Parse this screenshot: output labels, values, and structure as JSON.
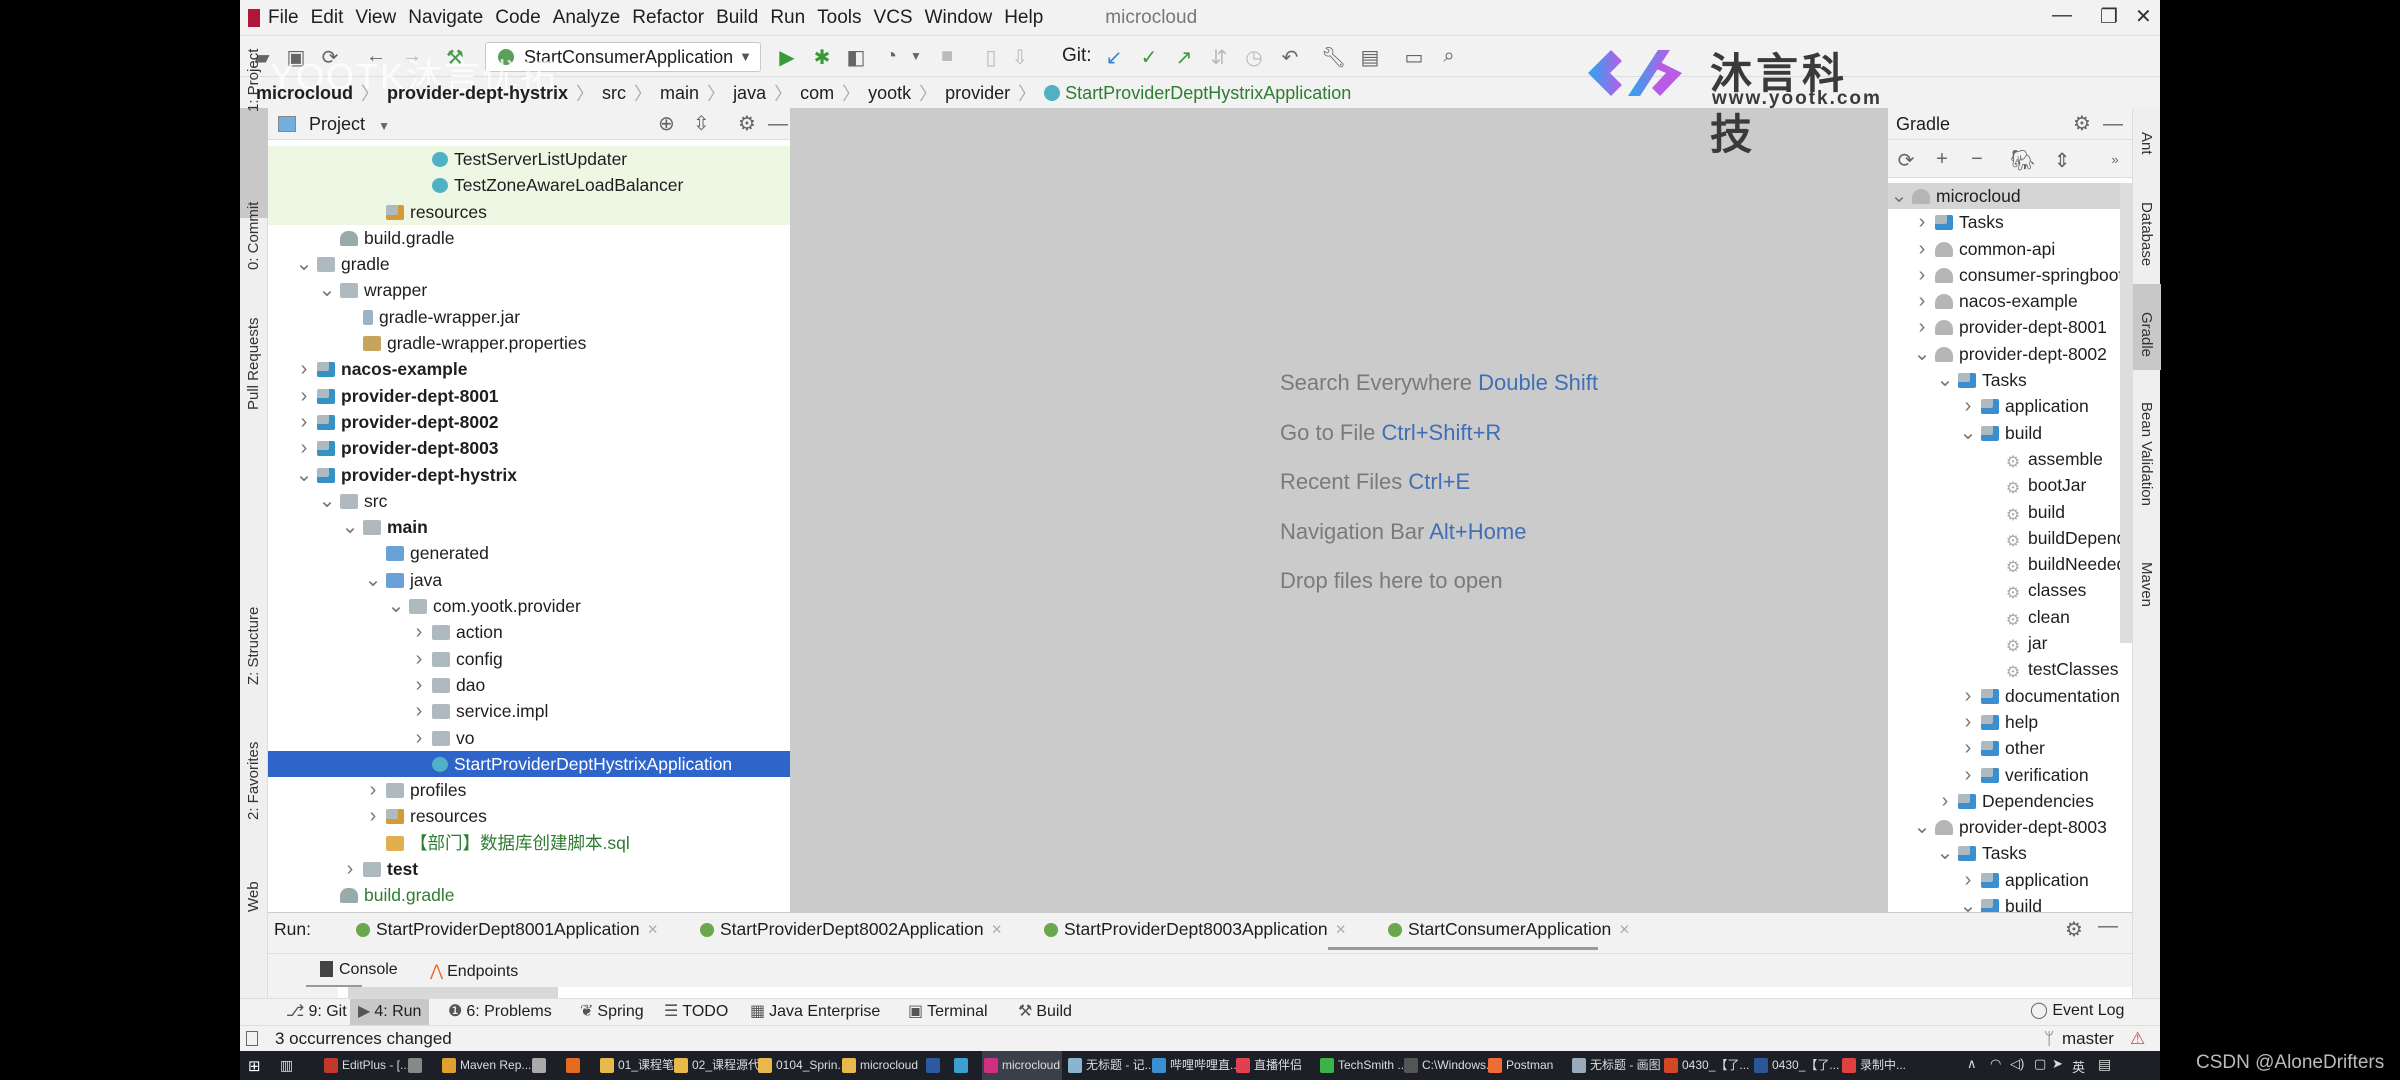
{
  "window": {
    "title": "microcloud"
  },
  "menu": [
    "File",
    "Edit",
    "View",
    "Navigate",
    "Code",
    "Analyze",
    "Refactor",
    "Build",
    "Run",
    "Tools",
    "VCS",
    "Window",
    "Help"
  ],
  "toolbar": {
    "run_config": "StartConsumerApplication",
    "git_label": "Git:"
  },
  "watermark": "YOOTK沐言优拓",
  "logo": {
    "name": "沐言科技",
    "url": "www.yootk.com"
  },
  "breadcrumb": [
    "microcloud",
    "provider-dept-hystrix",
    "src",
    "main",
    "java",
    "com",
    "yootk",
    "provider",
    "StartProviderDeptHystrixApplication"
  ],
  "left_stripe": [
    "1: Project",
    "0: Commit",
    "Pull Requests",
    "Z: Structure",
    "2: Favorites",
    "Web"
  ],
  "right_stripe": [
    "Ant",
    "Database",
    "Gradle",
    "Bean Validation",
    "Maven"
  ],
  "project": {
    "title": "Project",
    "rows": [
      {
        "label": "TestServerListUpdater",
        "level": 6,
        "arrow": "",
        "icon": "cls",
        "style": "hl"
      },
      {
        "label": "TestZoneAwareLoadBalancer",
        "level": 6,
        "arrow": "",
        "icon": "cls",
        "style": "hl"
      },
      {
        "label": "resources",
        "level": 4,
        "arrow": "",
        "icon": "res",
        "style": "hl"
      },
      {
        "label": "build.gradle",
        "level": 2,
        "arrow": "",
        "icon": "gradle",
        "style": ""
      },
      {
        "label": "gradle",
        "level": 1,
        "arrow": "expanded",
        "icon": "folder",
        "style": ""
      },
      {
        "label": "wrapper",
        "level": 2,
        "arrow": "expanded",
        "icon": "folder",
        "style": ""
      },
      {
        "label": "gradle-wrapper.jar",
        "level": 3,
        "arrow": "",
        "icon": "jar",
        "style": ""
      },
      {
        "label": "gradle-wrapper.properties",
        "level": 3,
        "arrow": "",
        "icon": "props",
        "style": ""
      },
      {
        "label": "nacos-example",
        "level": 1,
        "arrow": "collapsed",
        "icon": "module",
        "style": "bold"
      },
      {
        "label": "provider-dept-8001",
        "level": 1,
        "arrow": "collapsed",
        "icon": "module",
        "style": "bold"
      },
      {
        "label": "provider-dept-8002",
        "level": 1,
        "arrow": "collapsed",
        "icon": "module",
        "style": "bold"
      },
      {
        "label": "provider-dept-8003",
        "level": 1,
        "arrow": "collapsed",
        "icon": "module",
        "style": "bold"
      },
      {
        "label": "provider-dept-hystrix",
        "level": 1,
        "arrow": "expanded",
        "icon": "module",
        "style": "bold"
      },
      {
        "label": "src",
        "level": 2,
        "arrow": "expanded",
        "icon": "folder",
        "style": ""
      },
      {
        "label": "main",
        "level": 3,
        "arrow": "expanded",
        "icon": "folder",
        "style": "bold"
      },
      {
        "label": "generated",
        "level": 4,
        "arrow": "",
        "icon": "src",
        "style": ""
      },
      {
        "label": "java",
        "level": 4,
        "arrow": "expanded",
        "icon": "src",
        "style": ""
      },
      {
        "label": "com.yootk.provider",
        "level": 5,
        "arrow": "expanded",
        "icon": "folder",
        "style": ""
      },
      {
        "label": "action",
        "level": 6,
        "arrow": "collapsed",
        "icon": "folder",
        "style": ""
      },
      {
        "label": "config",
        "level": 6,
        "arrow": "collapsed",
        "icon": "folder",
        "style": ""
      },
      {
        "label": "dao",
        "level": 6,
        "arrow": "collapsed",
        "icon": "folder",
        "style": ""
      },
      {
        "label": "service.impl",
        "level": 6,
        "arrow": "collapsed",
        "icon": "folder",
        "style": ""
      },
      {
        "label": "vo",
        "level": 6,
        "arrow": "collapsed",
        "icon": "folder",
        "style": ""
      },
      {
        "label": "StartProviderDeptHystrixApplication",
        "level": 6,
        "arrow": "",
        "icon": "cls",
        "style": "sel"
      },
      {
        "label": "profiles",
        "level": 4,
        "arrow": "collapsed",
        "icon": "folder",
        "style": ""
      },
      {
        "label": "resources",
        "level": 4,
        "arrow": "collapsed",
        "icon": "res",
        "style": ""
      },
      {
        "label": "【部门】数据库创建脚本.sql",
        "level": 4,
        "arrow": "",
        "icon": "sql",
        "style": "green"
      },
      {
        "label": "test",
        "level": 3,
        "arrow": "collapsed",
        "icon": "folder",
        "style": "bold"
      },
      {
        "label": "build.gradle",
        "level": 2,
        "arrow": "",
        "icon": "gradle",
        "style": "green"
      }
    ]
  },
  "editor_hints": [
    {
      "text": "Search Everywhere",
      "key": "Double Shift"
    },
    {
      "text": "Go to File",
      "key": "Ctrl+Shift+R"
    },
    {
      "text": "Recent Files",
      "key": "Ctrl+E"
    },
    {
      "text": "Navigation Bar",
      "key": "Alt+Home"
    },
    {
      "text": "Drop files here to open",
      "key": ""
    }
  ],
  "gradle": {
    "title": "Gradle",
    "rows": [
      {
        "label": "microcloud",
        "level": 0,
        "arrow": "expanded",
        "icon": "gr",
        "style": "gsel"
      },
      {
        "label": "Tasks",
        "level": 1,
        "arrow": "collapsed",
        "icon": "task",
        "style": ""
      },
      {
        "label": "common-api",
        "level": 1,
        "arrow": "collapsed",
        "icon": "gr",
        "style": ""
      },
      {
        "label": "consumer-springboot",
        "level": 1,
        "arrow": "collapsed",
        "icon": "gr",
        "style": ""
      },
      {
        "label": "nacos-example",
        "level": 1,
        "arrow": "collapsed",
        "icon": "gr",
        "style": ""
      },
      {
        "label": "provider-dept-8001",
        "level": 1,
        "arrow": "collapsed",
        "icon": "gr",
        "style": ""
      },
      {
        "label": "provider-dept-8002",
        "level": 1,
        "arrow": "expanded",
        "icon": "gr",
        "style": ""
      },
      {
        "label": "Tasks",
        "level": 2,
        "arrow": "expanded",
        "icon": "task",
        "style": ""
      },
      {
        "label": "application",
        "level": 3,
        "arrow": "collapsed",
        "icon": "task",
        "style": ""
      },
      {
        "label": "build",
        "level": 3,
        "arrow": "expanded",
        "icon": "task",
        "style": ""
      },
      {
        "label": "assemble",
        "level": 4,
        "arrow": "",
        "icon": "gear",
        "style": ""
      },
      {
        "label": "bootJar",
        "level": 4,
        "arrow": "",
        "icon": "gear",
        "style": ""
      },
      {
        "label": "build",
        "level": 4,
        "arrow": "",
        "icon": "gear",
        "style": ""
      },
      {
        "label": "buildDependents",
        "level": 4,
        "arrow": "",
        "icon": "gear",
        "style": ""
      },
      {
        "label": "buildNeeded",
        "level": 4,
        "arrow": "",
        "icon": "gear",
        "style": ""
      },
      {
        "label": "classes",
        "level": 4,
        "arrow": "",
        "icon": "gear",
        "style": ""
      },
      {
        "label": "clean",
        "level": 4,
        "arrow": "",
        "icon": "gear",
        "style": ""
      },
      {
        "label": "jar",
        "level": 4,
        "arrow": "",
        "icon": "gear",
        "style": ""
      },
      {
        "label": "testClasses",
        "level": 4,
        "arrow": "",
        "icon": "gear",
        "style": ""
      },
      {
        "label": "documentation",
        "level": 3,
        "arrow": "collapsed",
        "icon": "task",
        "style": ""
      },
      {
        "label": "help",
        "level": 3,
        "arrow": "collapsed",
        "icon": "task",
        "style": ""
      },
      {
        "label": "other",
        "level": 3,
        "arrow": "collapsed",
        "icon": "task",
        "style": ""
      },
      {
        "label": "verification",
        "level": 3,
        "arrow": "collapsed",
        "icon": "task",
        "style": ""
      },
      {
        "label": "Dependencies",
        "level": 2,
        "arrow": "collapsed",
        "icon": "task",
        "style": ""
      },
      {
        "label": "provider-dept-8003",
        "level": 1,
        "arrow": "expanded",
        "icon": "gr",
        "style": ""
      },
      {
        "label": "Tasks",
        "level": 2,
        "arrow": "expanded",
        "icon": "task",
        "style": ""
      },
      {
        "label": "application",
        "level": 3,
        "arrow": "collapsed",
        "icon": "task",
        "style": ""
      },
      {
        "label": "build",
        "level": 3,
        "arrow": "expanded",
        "icon": "task",
        "style": ""
      }
    ]
  },
  "run": {
    "label": "Run:",
    "tabs": [
      "StartProviderDept8001Application",
      "StartProviderDept8002Application",
      "StartProviderDept8003Application",
      "StartConsumerApplication"
    ],
    "active_tab": 3,
    "subtabs": [
      "Console",
      "Endpoints"
    ]
  },
  "tool_windows": [
    "9: Git",
    "4: Run",
    "6: Problems",
    "Spring",
    "TODO",
    "Java Enterprise",
    "Terminal",
    "Build"
  ],
  "event_log": "Event Log",
  "status": {
    "message": "3 occurrences changed",
    "branch": "master"
  },
  "taskbar": [
    {
      "label": "EditPlus - [...",
      "color": "#c0392b"
    },
    {
      "label": "",
      "color": "#888"
    },
    {
      "label": "Maven Rep...",
      "color": "#e0a030"
    },
    {
      "label": "",
      "color": "#aaa"
    },
    {
      "label": "",
      "color": "#e66b1f"
    },
    {
      "label": "01_课程笔记",
      "color": "#e8b84a"
    },
    {
      "label": "02_课程源代...",
      "color": "#e8b84a"
    },
    {
      "label": "0104_Sprin...",
      "color": "#e8b84a"
    },
    {
      "label": "microcloud",
      "color": "#e8b84a"
    },
    {
      "label": "",
      "color": "#2c5aa0"
    },
    {
      "label": "",
      "color": "#3aa0d0"
    },
    {
      "label": "microcloud",
      "color": "#d03080",
      "active": true
    },
    {
      "label": "无标题 - 记...",
      "color": "#8ab4d0"
    },
    {
      "label": "哔哩哔哩直...",
      "color": "#3a8fd0"
    },
    {
      "label": "直播伴侣",
      "color": "#e04050"
    },
    {
      "label": "TechSmith ...",
      "color": "#3cb34a"
    },
    {
      "label": "C:\\Windows...",
      "color": "#555"
    },
    {
      "label": "Postman",
      "color": "#ef6c35"
    },
    {
      "label": "无标题 - 画图",
      "color": "#9ab"
    },
    {
      "label": "0430_【了...",
      "color": "#d24726"
    },
    {
      "label": "0430_【了...",
      "color": "#2b579a"
    },
    {
      "label": "录制中...",
      "color": "#e04040"
    }
  ],
  "tray": {
    "ime": "英"
  },
  "credit": "CSDN @AloneDrifters",
  "colors": {
    "selection": "#2f65ca",
    "editor_bg": "#cbcbcb",
    "link_key": "#3f6fb5"
  }
}
